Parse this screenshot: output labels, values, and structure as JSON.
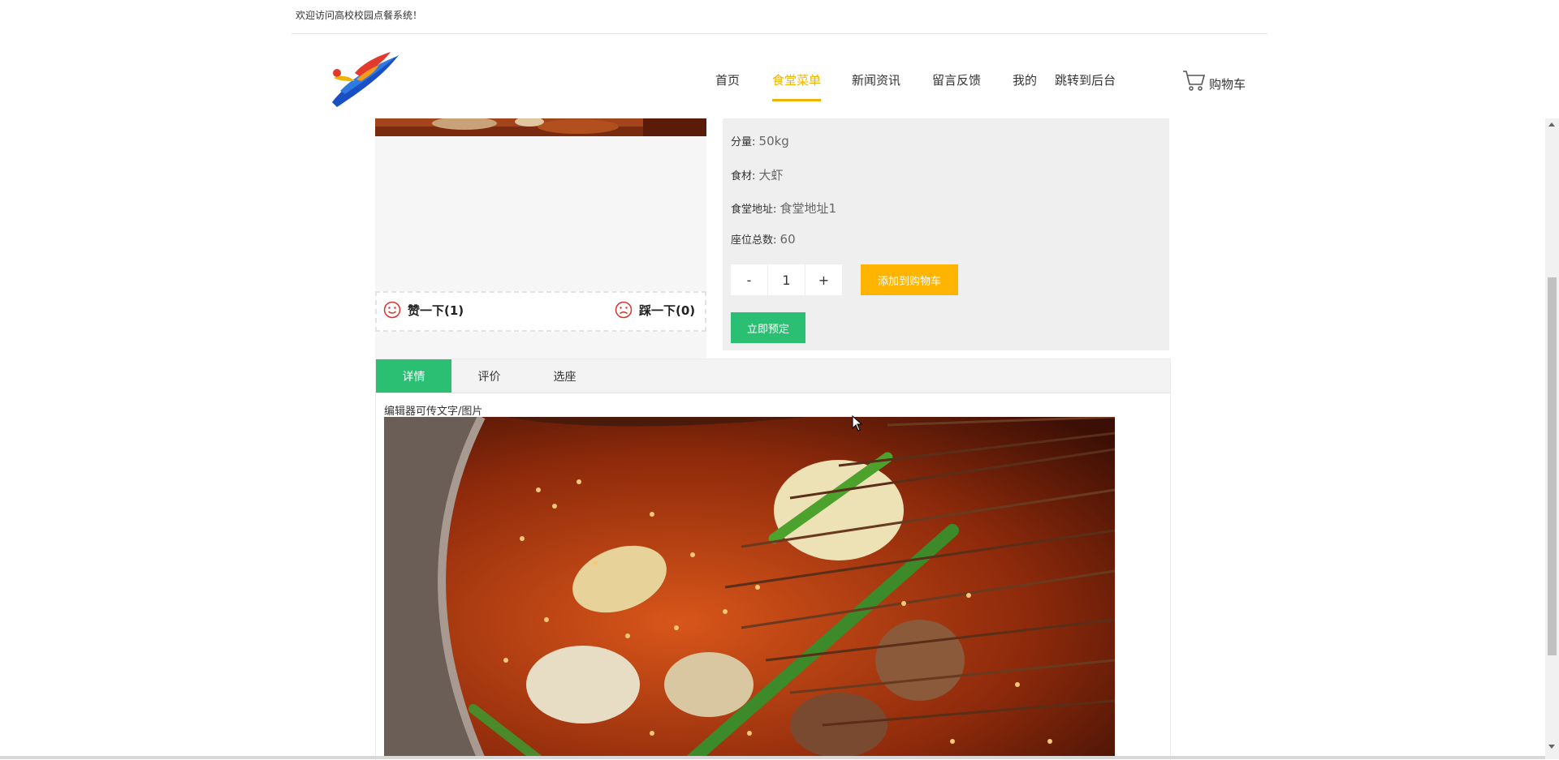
{
  "topbar": {
    "welcome": "欢迎访问高校校园点餐系统！"
  },
  "nav": {
    "items": [
      "首页",
      "食堂菜单",
      "新闻资讯",
      "留言反馈",
      "我的",
      "跳转到后台"
    ],
    "active_index": 1,
    "cart_label": "购物车"
  },
  "vote": {
    "like": "赞一下(1)",
    "dislike": "踩一下(0)"
  },
  "info": {
    "portion_label": "分量:",
    "portion_value": "50kg",
    "ingredient_label": "食材:",
    "ingredient_value": "大虾",
    "address_label": "食堂地址:",
    "address_value": "食堂地址1",
    "seats_label": "座位总数:",
    "seats_value": "60"
  },
  "stepper": {
    "minus": "-",
    "quantity": "1",
    "plus": "+"
  },
  "buttons": {
    "add_to_cart": "添加到购物车",
    "reserve": "立即预定"
  },
  "tabs": [
    {
      "label": "详情"
    },
    {
      "label": "评价"
    },
    {
      "label": "选座"
    }
  ],
  "detail": {
    "editor_note": "编辑器可传文字/图片"
  },
  "colors": {
    "accent_yellow": "#f0b400",
    "button_yellow": "#ffb400",
    "green": "#2bbf74"
  }
}
